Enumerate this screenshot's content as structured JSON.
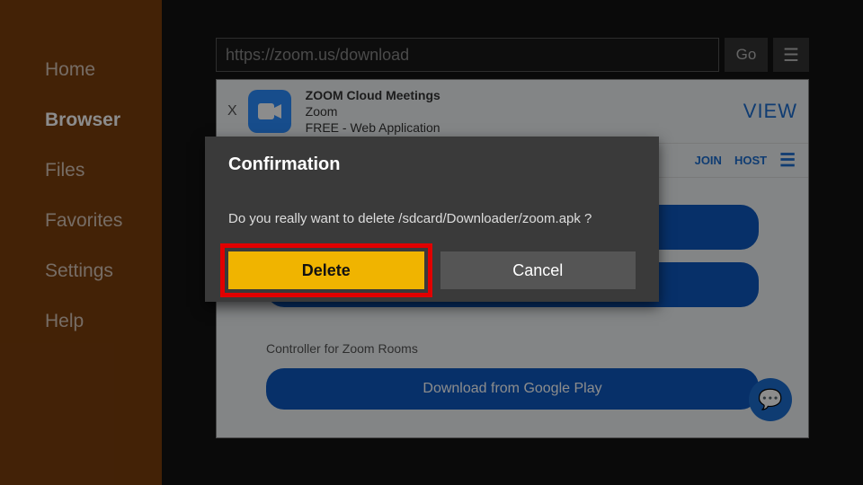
{
  "sidebar": {
    "items": [
      {
        "label": "Home"
      },
      {
        "label": "Browser"
      },
      {
        "label": "Files"
      },
      {
        "label": "Favorites"
      },
      {
        "label": "Settings"
      },
      {
        "label": "Help"
      }
    ],
    "active_index": 1
  },
  "urlbar": {
    "url": "https://zoom.us/download",
    "go_label": "Go",
    "menu_glyph": "☰"
  },
  "banner": {
    "close_glyph": "X",
    "app_name": "ZOOM Cloud Meetings",
    "vendor": "Zoom",
    "price_line": "FREE - Web Application",
    "view_label": "VIEW",
    "cam_glyph": "■"
  },
  "subheader": {
    "join_label": "JOIN",
    "host_label": "HOST",
    "menu_glyph": "☰"
  },
  "content": {
    "controller_label": "Controller for Zoom Rooms",
    "download_label": "Download from Google Play",
    "chat_glyph": "💬"
  },
  "dialog": {
    "title": "Confirmation",
    "message": "Do you really want to delete /sdcard/Downloader/zoom.apk ?",
    "delete_label": "Delete",
    "cancel_label": "Cancel"
  }
}
